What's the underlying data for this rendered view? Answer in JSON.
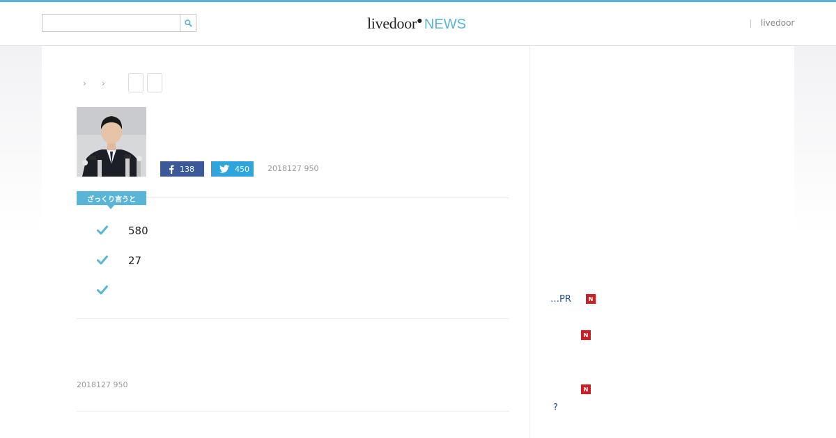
{
  "header": {
    "search_placeholder": "",
    "logo_main": "livedoor",
    "logo_news": "NEWS",
    "top_link": "livedoor"
  },
  "article": {
    "facebook_count": "138",
    "twitter_count": "450",
    "date": "2018127 950",
    "summary_label": "ざっくり言うと",
    "points": [
      "580",
      "27",
      ""
    ],
    "footer_date": "2018127 950"
  },
  "sidebar": {
    "links": [
      {
        "text": "…PR",
        "badge": "N"
      },
      {
        "text": "",
        "badge": "N"
      },
      {
        "text": "",
        "badge": "N"
      },
      {
        "text": "?",
        "badge": ""
      }
    ]
  },
  "colors": {
    "accent": "#59b5d8",
    "facebook": "#3b5998",
    "twitter": "#2ea6dd",
    "badge": "#cf1d24",
    "link": "#23528a"
  }
}
